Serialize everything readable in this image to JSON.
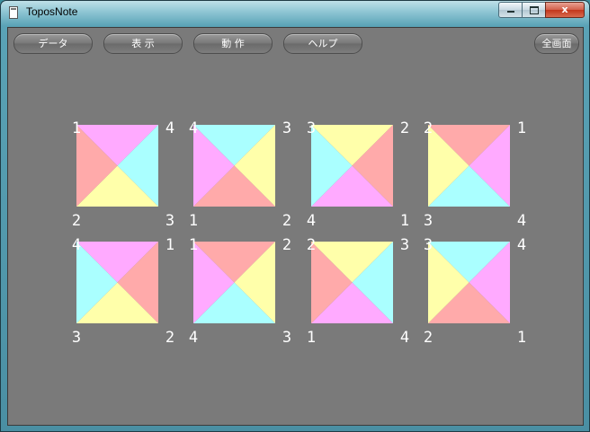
{
  "window": {
    "title": "ToposNote",
    "close_glyph": "x"
  },
  "menu": {
    "data_label": "データ",
    "view_label": "表 示",
    "action_label": "動 作",
    "help_label": "ヘルプ",
    "fullscreen_label": "全画面"
  },
  "colors": {
    "pink": "#ffaaff",
    "cyan": "#aaffff",
    "yellow": "#ffffaa",
    "salmon": "#ffaaaa",
    "client_bg": "#7a7a7a"
  },
  "tiles": [
    {
      "corners": {
        "tl": "1",
        "tr": "4",
        "bl": "2",
        "br": "3"
      },
      "triangles": {
        "top": "pink",
        "right": "cyan",
        "bottom": "yellow",
        "left": "salmon"
      }
    },
    {
      "corners": {
        "tl": "4",
        "tr": "3",
        "bl": "1",
        "br": "2"
      },
      "triangles": {
        "top": "cyan",
        "right": "yellow",
        "bottom": "salmon",
        "left": "pink"
      }
    },
    {
      "corners": {
        "tl": "3",
        "tr": "2",
        "bl": "4",
        "br": "1"
      },
      "triangles": {
        "top": "yellow",
        "right": "salmon",
        "bottom": "pink",
        "left": "cyan"
      }
    },
    {
      "corners": {
        "tl": "2",
        "tr": "1",
        "bl": "3",
        "br": "4"
      },
      "triangles": {
        "top": "salmon",
        "right": "pink",
        "bottom": "cyan",
        "left": "yellow"
      }
    },
    {
      "corners": {
        "tl": "4",
        "tr": "1",
        "bl": "3",
        "br": "2"
      },
      "triangles": {
        "top": "pink",
        "right": "salmon",
        "bottom": "yellow",
        "left": "cyan"
      }
    },
    {
      "corners": {
        "tl": "1",
        "tr": "2",
        "bl": "4",
        "br": "3"
      },
      "triangles": {
        "top": "salmon",
        "right": "yellow",
        "bottom": "cyan",
        "left": "pink"
      }
    },
    {
      "corners": {
        "tl": "2",
        "tr": "3",
        "bl": "1",
        "br": "4"
      },
      "triangles": {
        "top": "yellow",
        "right": "cyan",
        "bottom": "pink",
        "left": "salmon"
      }
    },
    {
      "corners": {
        "tl": "3",
        "tr": "4",
        "bl": "2",
        "br": "1"
      },
      "triangles": {
        "top": "cyan",
        "right": "pink",
        "bottom": "salmon",
        "left": "yellow"
      }
    }
  ]
}
